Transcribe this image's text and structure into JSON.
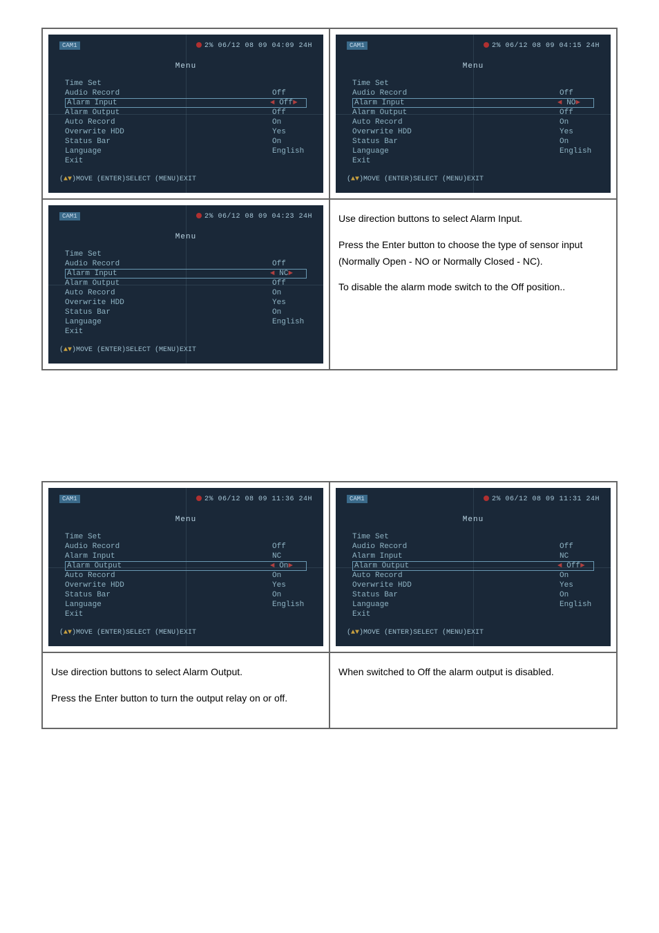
{
  "menu_title": "Menu",
  "hint_line_prefix": "(",
  "hint_move": ")MOVE (ENTER)SELECT (MENU)EXIT",
  "screens": {
    "s1": {
      "timestamp": "2%  06/12 08 09 04:09  24H",
      "rows": [
        {
          "label": "Time Set",
          "value": "",
          "sel": false
        },
        {
          "label": "Audio Record",
          "value": "Off",
          "sel": false
        },
        {
          "label": "Alarm Input",
          "value": "Off",
          "sel": true,
          "arrows": true
        },
        {
          "label": "Alarm Output",
          "value": "Off",
          "sel": false
        },
        {
          "label": "Auto Record",
          "value": "On",
          "sel": false
        },
        {
          "label": "Overwrite HDD",
          "value": "Yes",
          "sel": false
        },
        {
          "label": "Status Bar",
          "value": "On",
          "sel": false
        },
        {
          "label": "Language",
          "value": "English",
          "sel": false
        },
        {
          "label": "Exit",
          "value": "",
          "sel": false
        }
      ]
    },
    "s2": {
      "timestamp": "2%  06/12 08 09 04:15  24H",
      "rows": [
        {
          "label": "Time Set",
          "value": "",
          "sel": false
        },
        {
          "label": "Audio Record",
          "value": "Off",
          "sel": false
        },
        {
          "label": "Alarm Input",
          "value": "NO",
          "sel": true,
          "arrows": true
        },
        {
          "label": "Alarm Output",
          "value": "Off",
          "sel": false
        },
        {
          "label": "Auto Record",
          "value": "On",
          "sel": false
        },
        {
          "label": "Overwrite HDD",
          "value": "Yes",
          "sel": false
        },
        {
          "label": "Status Bar",
          "value": "On",
          "sel": false
        },
        {
          "label": "Language",
          "value": "English",
          "sel": false
        },
        {
          "label": "Exit",
          "value": "",
          "sel": false
        }
      ]
    },
    "s3": {
      "timestamp": "2%  06/12 08 09 04:23  24H",
      "rows": [
        {
          "label": "Time Set",
          "value": "",
          "sel": false
        },
        {
          "label": "Audio Record",
          "value": "Off",
          "sel": false
        },
        {
          "label": "Alarm Input",
          "value": "NC",
          "sel": true,
          "arrows": true
        },
        {
          "label": "Alarm Output",
          "value": "Off",
          "sel": false
        },
        {
          "label": "Auto Record",
          "value": "On",
          "sel": false
        },
        {
          "label": "Overwrite HDD",
          "value": "Yes",
          "sel": false
        },
        {
          "label": "Status Bar",
          "value": "On",
          "sel": false
        },
        {
          "label": "Language",
          "value": "English",
          "sel": false
        },
        {
          "label": "Exit",
          "value": "",
          "sel": false
        }
      ]
    },
    "s4": {
      "timestamp": "2%  06/12 08 09 11:36  24H",
      "rows": [
        {
          "label": "Time Set",
          "value": "",
          "sel": false
        },
        {
          "label": "Audio Record",
          "value": "Off",
          "sel": false
        },
        {
          "label": "Alarm Input",
          "value": "NC",
          "sel": false
        },
        {
          "label": "Alarm Output",
          "value": "On",
          "sel": true,
          "arrows": true
        },
        {
          "label": "Auto Record",
          "value": "On",
          "sel": false
        },
        {
          "label": "Overwrite HDD",
          "value": "Yes",
          "sel": false
        },
        {
          "label": "Status Bar",
          "value": "On",
          "sel": false
        },
        {
          "label": "Language",
          "value": "English",
          "sel": false
        },
        {
          "label": "Exit",
          "value": "",
          "sel": false
        }
      ]
    },
    "s5": {
      "timestamp": "2%  06/12 08 09 11:31  24H",
      "rows": [
        {
          "label": "Time Set",
          "value": "",
          "sel": false
        },
        {
          "label": "Audio Record",
          "value": "Off",
          "sel": false
        },
        {
          "label": "Alarm Input",
          "value": "NC",
          "sel": false
        },
        {
          "label": "Alarm Output",
          "value": "Off",
          "sel": true,
          "arrows": true
        },
        {
          "label": "Auto Record",
          "value": "On",
          "sel": false
        },
        {
          "label": "Overwrite HDD",
          "value": "Yes",
          "sel": false
        },
        {
          "label": "Status Bar",
          "value": "On",
          "sel": false
        },
        {
          "label": "Language",
          "value": "English",
          "sel": false
        },
        {
          "label": "Exit",
          "value": "",
          "sel": false
        }
      ]
    }
  },
  "desc": {
    "alarm_input": [
      "Use direction buttons to select Alarm Input.",
      "Press the Enter button to choose the type of sensor input (Normally Open - NO or Normally Closed - NC).",
      "To disable the alarm mode switch to the Off position.."
    ],
    "alarm_output_left": [
      "Use direction buttons to select Alarm Output.",
      "Press the Enter button to turn the output relay on or off."
    ],
    "alarm_output_right": [
      "When switched to Off the alarm output is disabled."
    ]
  }
}
